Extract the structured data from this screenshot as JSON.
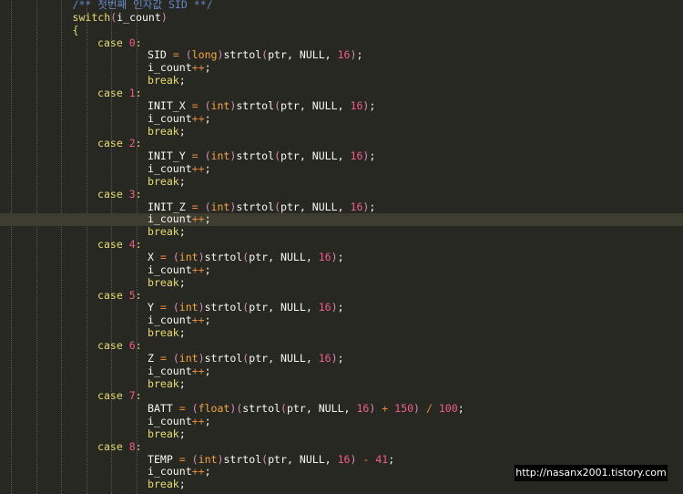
{
  "editor": {
    "theme_colors": {
      "background": "#272822",
      "current_line": "#3e3d32",
      "comment": "#6a86c8",
      "keyword": "#e6db74",
      "type": "#f5a545",
      "number": "#f25c8c",
      "operator": "#e58a3b",
      "identifier": "#f8f8f2",
      "paren": "#d98cbd"
    },
    "current_line_index": 17,
    "lines": [
      {
        "indent": 3,
        "tokens": [
          [
            "cm",
            "/** 첫번째 인자값 SID **/"
          ]
        ]
      },
      {
        "indent": 3,
        "tokens": [
          [
            "kw",
            "switch"
          ],
          [
            "pn",
            "("
          ],
          [
            "id",
            "i_count"
          ],
          [
            "pn",
            ")"
          ]
        ]
      },
      {
        "indent": 3,
        "tokens": [
          [
            "br",
            "{"
          ]
        ]
      },
      {
        "indent": 4,
        "tokens": [
          [
            "kw",
            "case "
          ],
          [
            "num",
            "0"
          ],
          [
            "kw",
            ":"
          ]
        ]
      },
      {
        "indent": 6,
        "tokens": [
          [
            "id",
            "SID "
          ],
          [
            "op",
            "= "
          ],
          [
            "pn",
            "("
          ],
          [
            "ty",
            "long"
          ],
          [
            "pn",
            ")"
          ],
          [
            "id",
            "strtol"
          ],
          [
            "pn",
            "("
          ],
          [
            "id",
            "ptr, NULL, "
          ],
          [
            "num",
            "16"
          ],
          [
            "pn",
            ")"
          ],
          [
            "id",
            ";"
          ]
        ]
      },
      {
        "indent": 6,
        "tokens": [
          [
            "id",
            "i_count"
          ],
          [
            "op",
            "++"
          ],
          [
            "id",
            ";"
          ]
        ]
      },
      {
        "indent": 6,
        "tokens": [
          [
            "kw",
            "break"
          ],
          [
            "id",
            ";"
          ]
        ]
      },
      {
        "indent": 4,
        "tokens": [
          [
            "kw",
            "case "
          ],
          [
            "num",
            "1"
          ],
          [
            "kw",
            ":"
          ]
        ]
      },
      {
        "indent": 6,
        "tokens": [
          [
            "id",
            "INIT_X "
          ],
          [
            "op",
            "= "
          ],
          [
            "pn",
            "("
          ],
          [
            "ty",
            "int"
          ],
          [
            "pn",
            ")"
          ],
          [
            "id",
            "strtol"
          ],
          [
            "pn",
            "("
          ],
          [
            "id",
            "ptr, NULL, "
          ],
          [
            "num",
            "16"
          ],
          [
            "pn",
            ")"
          ],
          [
            "id",
            ";"
          ]
        ]
      },
      {
        "indent": 6,
        "tokens": [
          [
            "id",
            "i_count"
          ],
          [
            "op",
            "++"
          ],
          [
            "id",
            ";"
          ]
        ]
      },
      {
        "indent": 6,
        "tokens": [
          [
            "kw",
            "break"
          ],
          [
            "id",
            ";"
          ]
        ]
      },
      {
        "indent": 4,
        "tokens": [
          [
            "kw",
            "case "
          ],
          [
            "num",
            "2"
          ],
          [
            "kw",
            ":"
          ]
        ]
      },
      {
        "indent": 6,
        "tokens": [
          [
            "id",
            "INIT_Y "
          ],
          [
            "op",
            "= "
          ],
          [
            "pn",
            "("
          ],
          [
            "ty",
            "int"
          ],
          [
            "pn",
            ")"
          ],
          [
            "id",
            "strtol"
          ],
          [
            "pn",
            "("
          ],
          [
            "id",
            "ptr, NULL, "
          ],
          [
            "num",
            "16"
          ],
          [
            "pn",
            ")"
          ],
          [
            "id",
            ";"
          ]
        ]
      },
      {
        "indent": 6,
        "tokens": [
          [
            "id",
            "i_count"
          ],
          [
            "op",
            "++"
          ],
          [
            "id",
            ";"
          ]
        ]
      },
      {
        "indent": 6,
        "tokens": [
          [
            "kw",
            "break"
          ],
          [
            "id",
            ";"
          ]
        ]
      },
      {
        "indent": 4,
        "tokens": [
          [
            "kw",
            "case "
          ],
          [
            "num",
            "3"
          ],
          [
            "kw",
            ":"
          ]
        ]
      },
      {
        "indent": 6,
        "tokens": [
          [
            "id",
            "INIT_Z "
          ],
          [
            "op",
            "= "
          ],
          [
            "pn",
            "("
          ],
          [
            "ty",
            "int"
          ],
          [
            "pn",
            ")"
          ],
          [
            "id",
            "strtol"
          ],
          [
            "pn",
            "("
          ],
          [
            "id",
            "ptr, NULL, "
          ],
          [
            "num",
            "16"
          ],
          [
            "pn",
            ")"
          ],
          [
            "id",
            ";"
          ]
        ]
      },
      {
        "indent": 6,
        "tokens": [
          [
            "id",
            "i_count"
          ],
          [
            "op",
            "++"
          ],
          [
            "id",
            ";"
          ]
        ]
      },
      {
        "indent": 6,
        "tokens": [
          [
            "kw",
            "break"
          ],
          [
            "id",
            ";"
          ]
        ]
      },
      {
        "indent": 4,
        "tokens": [
          [
            "kw",
            "case "
          ],
          [
            "num",
            "4"
          ],
          [
            "kw",
            ":"
          ]
        ]
      },
      {
        "indent": 6,
        "tokens": [
          [
            "id",
            "X "
          ],
          [
            "op",
            "= "
          ],
          [
            "pn",
            "("
          ],
          [
            "ty",
            "int"
          ],
          [
            "pn",
            ")"
          ],
          [
            "id",
            "strtol"
          ],
          [
            "pn",
            "("
          ],
          [
            "id",
            "ptr, NULL, "
          ],
          [
            "num",
            "16"
          ],
          [
            "pn",
            ")"
          ],
          [
            "id",
            ";"
          ]
        ]
      },
      {
        "indent": 6,
        "tokens": [
          [
            "id",
            "i_count"
          ],
          [
            "op",
            "++"
          ],
          [
            "id",
            ";"
          ]
        ]
      },
      {
        "indent": 6,
        "tokens": [
          [
            "kw",
            "break"
          ],
          [
            "id",
            ";"
          ]
        ]
      },
      {
        "indent": 4,
        "tokens": [
          [
            "kw",
            "case "
          ],
          [
            "num",
            "5"
          ],
          [
            "kw",
            ":"
          ]
        ]
      },
      {
        "indent": 6,
        "tokens": [
          [
            "id",
            "Y "
          ],
          [
            "op",
            "= "
          ],
          [
            "pn",
            "("
          ],
          [
            "ty",
            "int"
          ],
          [
            "pn",
            ")"
          ],
          [
            "id",
            "strtol"
          ],
          [
            "pn",
            "("
          ],
          [
            "id",
            "ptr, NULL, "
          ],
          [
            "num",
            "16"
          ],
          [
            "pn",
            ")"
          ],
          [
            "id",
            ";"
          ]
        ]
      },
      {
        "indent": 6,
        "tokens": [
          [
            "id",
            "i_count"
          ],
          [
            "op",
            "++"
          ],
          [
            "id",
            ";"
          ]
        ]
      },
      {
        "indent": 6,
        "tokens": [
          [
            "kw",
            "break"
          ],
          [
            "id",
            ";"
          ]
        ]
      },
      {
        "indent": 4,
        "tokens": [
          [
            "kw",
            "case "
          ],
          [
            "num",
            "6"
          ],
          [
            "kw",
            ":"
          ]
        ]
      },
      {
        "indent": 6,
        "tokens": [
          [
            "id",
            "Z "
          ],
          [
            "op",
            "= "
          ],
          [
            "pn",
            "("
          ],
          [
            "ty",
            "int"
          ],
          [
            "pn",
            ")"
          ],
          [
            "id",
            "strtol"
          ],
          [
            "pn",
            "("
          ],
          [
            "id",
            "ptr, NULL, "
          ],
          [
            "num",
            "16"
          ],
          [
            "pn",
            ")"
          ],
          [
            "id",
            ";"
          ]
        ]
      },
      {
        "indent": 6,
        "tokens": [
          [
            "id",
            "i_count"
          ],
          [
            "op",
            "++"
          ],
          [
            "id",
            ";"
          ]
        ]
      },
      {
        "indent": 6,
        "tokens": [
          [
            "kw",
            "break"
          ],
          [
            "id",
            ";"
          ]
        ]
      },
      {
        "indent": 4,
        "tokens": [
          [
            "kw",
            "case "
          ],
          [
            "num",
            "7"
          ],
          [
            "kw",
            ":"
          ]
        ]
      },
      {
        "indent": 6,
        "tokens": [
          [
            "id",
            "BATT "
          ],
          [
            "op",
            "= "
          ],
          [
            "pn",
            "("
          ],
          [
            "ty",
            "float"
          ],
          [
            "pn",
            ")("
          ],
          [
            "id",
            "strtol"
          ],
          [
            "pn",
            "("
          ],
          [
            "id",
            "ptr, NULL, "
          ],
          [
            "num",
            "16"
          ],
          [
            "pn",
            ") "
          ],
          [
            "op",
            "+ "
          ],
          [
            "num",
            "150"
          ],
          [
            "pn",
            ") "
          ],
          [
            "op",
            "/ "
          ],
          [
            "num",
            "100"
          ],
          [
            "id",
            ";"
          ]
        ]
      },
      {
        "indent": 6,
        "tokens": [
          [
            "id",
            "i_count"
          ],
          [
            "op",
            "++"
          ],
          [
            "id",
            ";"
          ]
        ]
      },
      {
        "indent": 6,
        "tokens": [
          [
            "kw",
            "break"
          ],
          [
            "id",
            ";"
          ]
        ]
      },
      {
        "indent": 4,
        "tokens": [
          [
            "kw",
            "case "
          ],
          [
            "num",
            "8"
          ],
          [
            "kw",
            ":"
          ]
        ]
      },
      {
        "indent": 6,
        "tokens": [
          [
            "id",
            "TEMP "
          ],
          [
            "op",
            "= "
          ],
          [
            "pn",
            "("
          ],
          [
            "ty",
            "int"
          ],
          [
            "pn",
            ")"
          ],
          [
            "id",
            "strtol"
          ],
          [
            "pn",
            "("
          ],
          [
            "id",
            "ptr, NULL, "
          ],
          [
            "num",
            "16"
          ],
          [
            "pn",
            ") "
          ],
          [
            "op",
            "- "
          ],
          [
            "num",
            "41"
          ],
          [
            "id",
            ";"
          ]
        ]
      },
      {
        "indent": 6,
        "tokens": [
          [
            "id",
            "i_count"
          ],
          [
            "op",
            "++"
          ],
          [
            "id",
            ";"
          ]
        ]
      },
      {
        "indent": 6,
        "tokens": [
          [
            "kw",
            "break"
          ],
          [
            "id",
            ";"
          ]
        ]
      }
    ]
  },
  "watermark": {
    "text": "http://nasanx2001.tistory.com"
  }
}
